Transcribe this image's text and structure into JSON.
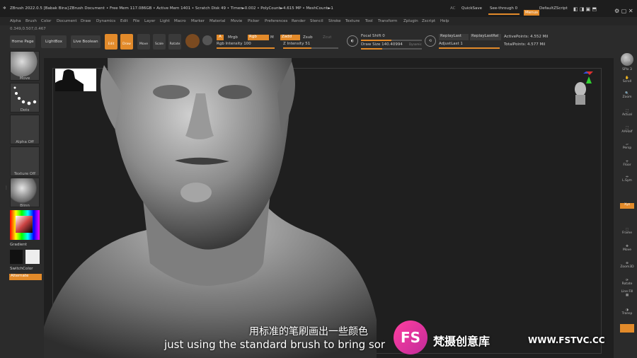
{
  "titlebar": {
    "app": "ZBrush 2022.0.5 [Babak Bina]",
    "document": "ZBrush Document",
    "stats": "• Free Mem 117.086GB • Active Mem 1401 • Scratch Disk 49 • Timer►0.002 • PolyCount►4.615 MP • MeshCount►1",
    "ac": "AC",
    "quicksave": "QuickSave",
    "see_through": "See-through  0",
    "menus": "Menus",
    "script": "DefaultZScript"
  },
  "menubar": [
    "Alpha",
    "Brush",
    "Color",
    "Document",
    "Draw",
    "Dynamics",
    "Edit",
    "File",
    "Layer",
    "Light",
    "Macro",
    "Marker",
    "Material",
    "Movie",
    "Picker",
    "Preferences",
    "Render",
    "Stencil",
    "Stroke",
    "Texture",
    "Tool",
    "Transform",
    "Zplugin",
    "Zscript",
    "Help"
  ],
  "coords": "0.349,0.507,0.467",
  "toolbar": {
    "home_page": "Home Page",
    "lightbox": "LightBox",
    "live_boolean": "Live Boolean",
    "edit": "Edit",
    "draw": "Draw",
    "move": "Move",
    "scale": "Scale",
    "rotate": "Rotate",
    "a": "A",
    "mrgb": "Mrgb",
    "rgb": "Rgb",
    "m": "M",
    "zadd": "Zadd",
    "zsub": "Zsub",
    "zcut": "Zcut",
    "rgb_intensity": "Rgb Intensity 100",
    "z_intensity": "Z Intensity 51",
    "focal_shift": "Focal Shift 0",
    "draw_size": "Draw Size 140.40994",
    "dynamic": "Dynamic",
    "replay_last": "ReplayLast",
    "replay_last_rel": "ReplayLastRel",
    "adjust_last": "AdjustLast 1",
    "active_points": "ActivePoints: 4.552 Mil",
    "total_points": "TotalPoints: 4.577 Mil"
  },
  "lefttray": {
    "brush": "Move",
    "stroke": "Dots",
    "alpha": "Alpha Off",
    "texture": "Texture Off",
    "material": "Blinn",
    "gradient": "Gradient",
    "switch_color": "SwitchColor",
    "alternate": "Alternate"
  },
  "rightshelf": [
    "BPR",
    "SPix 3",
    "Scroll",
    "Zoom",
    "Actual",
    "AAHalf",
    "Persp",
    "Floor",
    "L.Sym",
    "Xyz",
    "Frame",
    "Move",
    "Zoom3D",
    "Rotate",
    "Line Fill",
    "Transp"
  ],
  "subtitles": {
    "cn": "用标准的笔刷画出一些颜色",
    "en": "just using the standard brush to bring sor"
  },
  "watermark": {
    "badge": "FS",
    "cn": "梵摄创意库",
    "url": "WWW.FSTVC.CC"
  },
  "colors": {
    "accent": "#e28a2a",
    "canvas": "#1f1f1f",
    "ui": "#2b2b2b"
  }
}
